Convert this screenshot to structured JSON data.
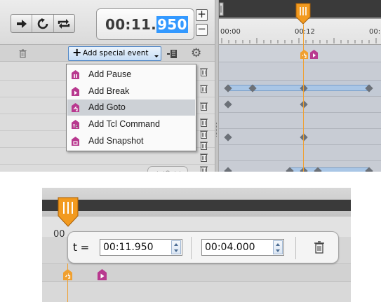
{
  "toolbar": {
    "time_main": "00:11.",
    "time_selected": "950",
    "plus_label": "+",
    "minus_label": "−",
    "icons": [
      "play-forward-icon",
      "loop-icon",
      "repeat-icon"
    ]
  },
  "ruler": {
    "labels": [
      "00:00",
      "00:12",
      "00:"
    ]
  },
  "add_event": {
    "label": "Add special event"
  },
  "menu": {
    "items": [
      {
        "label": "Add Pause",
        "icon": "pause-event-icon",
        "highlighted": false
      },
      {
        "label": "Add Break",
        "icon": "break-event-icon",
        "highlighted": false
      },
      {
        "label": "Add Goto",
        "icon": "goto-event-icon",
        "highlighted": true
      },
      {
        "label": "Add Tcl Command",
        "icon": "tcl-event-icon",
        "highlighted": false
      },
      {
        "label": "Add Snapshot",
        "icon": "snapshot-event-icon",
        "highlighted": false
      }
    ]
  },
  "detail": {
    "ruler_label": "00",
    "t_label": "t =",
    "time_value": "00:11.950",
    "duration_value": "00:04.000"
  },
  "colors": {
    "accent_orange": "#f0a030",
    "event_magenta": "#b8398f",
    "selection_blue": "#3399ff",
    "range_blue": "#a9c6e6"
  }
}
